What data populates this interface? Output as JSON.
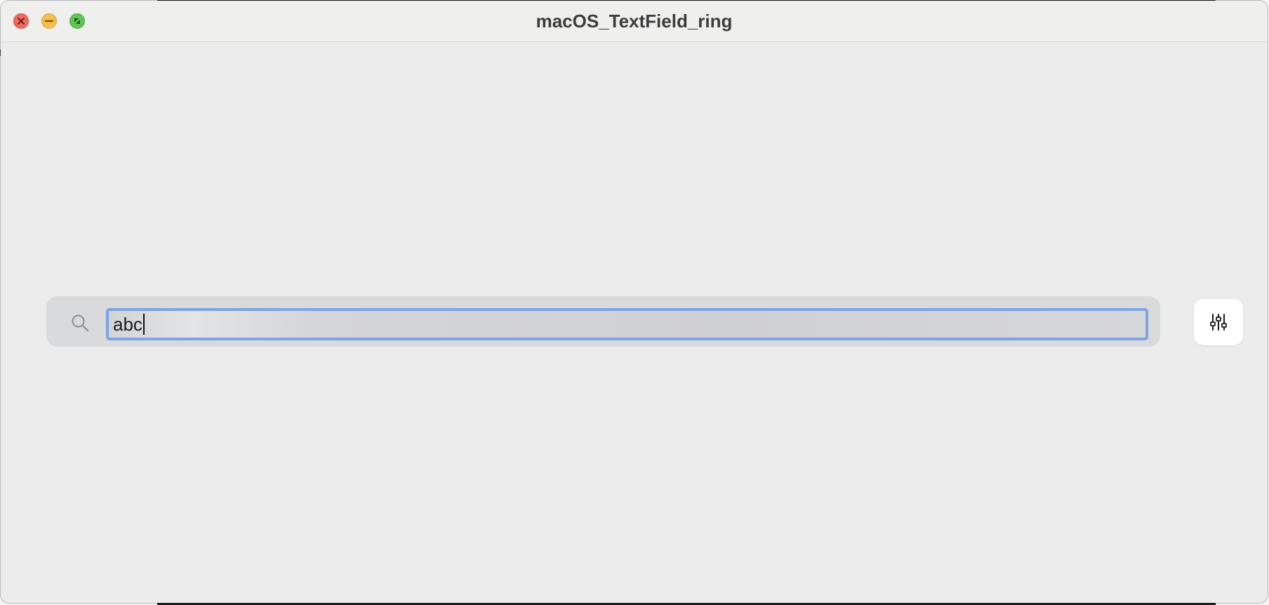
{
  "window": {
    "title": "macOS_TextField_ring"
  },
  "traffic_lights": {
    "close_icon": "close-x",
    "minimize_icon": "minus",
    "zoom_icon": "fullscreen-arrows",
    "colors": {
      "close": "#ed6a5e",
      "minimize": "#f5bf4f",
      "zoom": "#61c554"
    }
  },
  "search": {
    "icon": "magnifying-glass",
    "value": "abc",
    "focus_ring_color": "#7ea3e6"
  },
  "filter_button": {
    "icon": "sliders-horizontal"
  },
  "backdrop": {
    "partial_glyph": "e"
  }
}
